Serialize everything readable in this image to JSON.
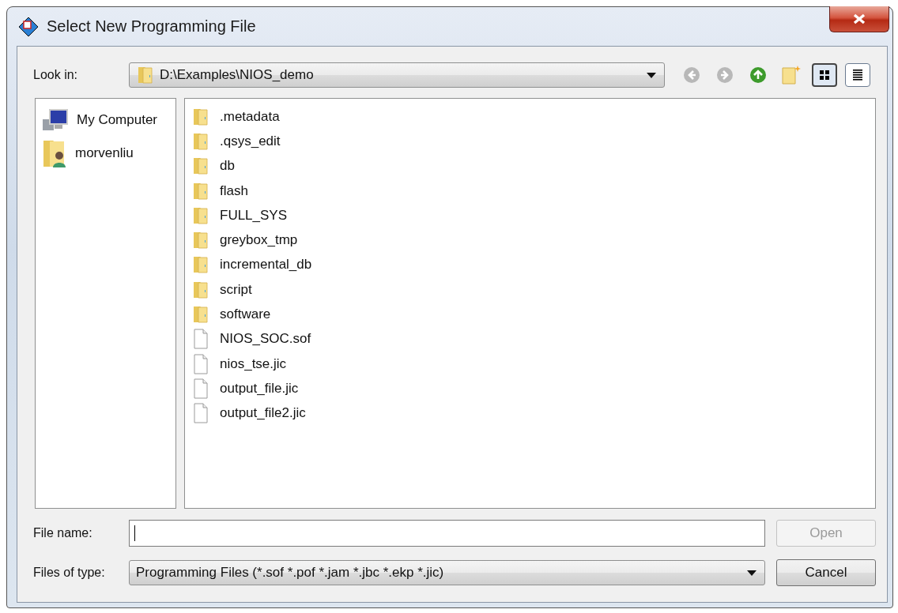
{
  "window": {
    "title": "Select New Programming File"
  },
  "look_in": {
    "label": "Look in:",
    "value": "D:\\Examples\\NIOS_demo"
  },
  "nav_buttons": [
    {
      "kind": "back",
      "disabled": true
    },
    {
      "kind": "forward",
      "disabled": true
    },
    {
      "kind": "up",
      "disabled": false
    },
    {
      "kind": "new_folder",
      "disabled": false
    }
  ],
  "view_buttons": [
    {
      "kind": "grid",
      "selected": true
    },
    {
      "kind": "list",
      "selected": false
    }
  ],
  "sidebar": {
    "items": [
      {
        "kind": "computer",
        "label": "My Computer"
      },
      {
        "kind": "user",
        "label": "morvenliu"
      }
    ]
  },
  "files": [
    {
      "kind": "folder",
      "name": ".metadata"
    },
    {
      "kind": "folder",
      "name": ".qsys_edit"
    },
    {
      "kind": "folder",
      "name": "db"
    },
    {
      "kind": "folder",
      "name": "flash"
    },
    {
      "kind": "folder",
      "name": "FULL_SYS"
    },
    {
      "kind": "folder",
      "name": "greybox_tmp"
    },
    {
      "kind": "folder",
      "name": "incremental_db"
    },
    {
      "kind": "folder",
      "name": "script"
    },
    {
      "kind": "folder",
      "name": "software"
    },
    {
      "kind": "file",
      "name": "NIOS_SOC.sof"
    },
    {
      "kind": "file",
      "name": "nios_tse.jic"
    },
    {
      "kind": "file",
      "name": "output_file.jic"
    },
    {
      "kind": "file",
      "name": "output_file2.jic"
    }
  ],
  "file_name": {
    "label": "File name:"
  },
  "files_of_type": {
    "label": "Files of type:",
    "value": "Programming Files (*.sof *.pof *.jam *.jbc *.ekp *.jic)"
  },
  "buttons": [
    {
      "label": "Open",
      "disabled": true
    },
    {
      "label": "Cancel",
      "disabled": false
    }
  ]
}
